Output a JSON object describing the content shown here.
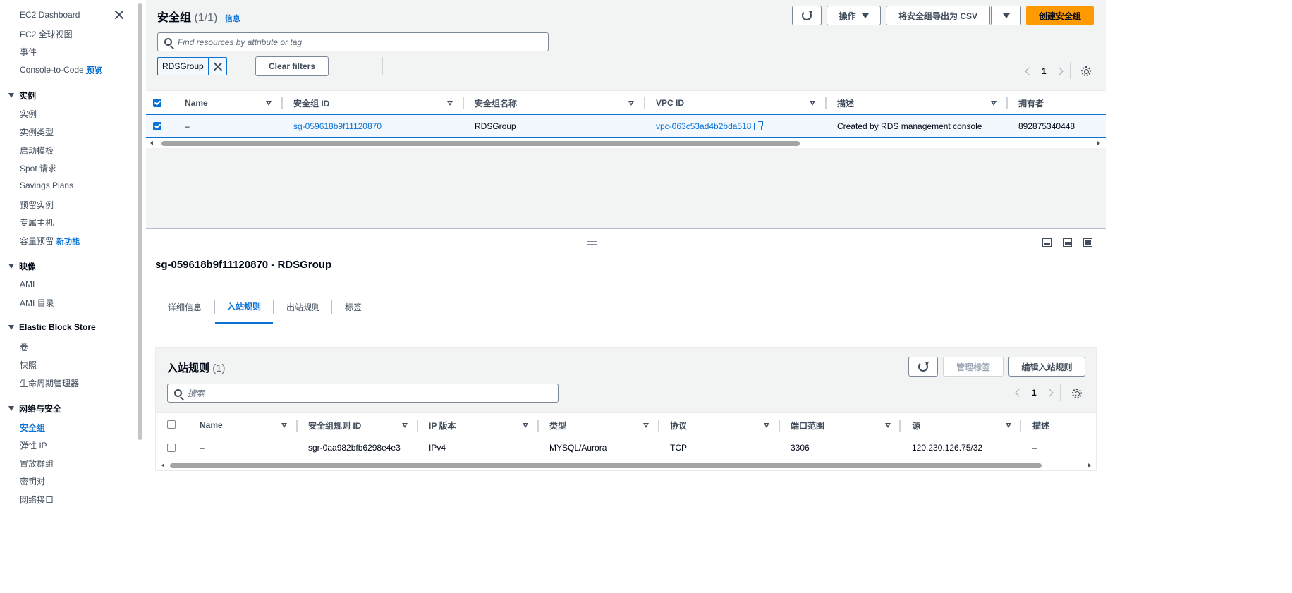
{
  "sidebar": {
    "top_items": [
      {
        "label": "EC2 Dashboard"
      },
      {
        "label": "EC2 全球视图"
      },
      {
        "label": "事件"
      },
      {
        "label": "Console-to-Code",
        "badge": "预览"
      }
    ],
    "sections": [
      {
        "title": "实例",
        "items": [
          {
            "label": "实例"
          },
          {
            "label": "实例类型"
          },
          {
            "label": "启动模板"
          },
          {
            "label": "Spot 请求"
          },
          {
            "label": "Savings Plans"
          },
          {
            "label": "预留实例"
          },
          {
            "label": "专属主机"
          },
          {
            "label": "容量预留",
            "badge": "新功能"
          }
        ]
      },
      {
        "title": "映像",
        "items": [
          {
            "label": "AMI"
          },
          {
            "label": "AMI 目录"
          }
        ]
      },
      {
        "title": "Elastic Block Store",
        "items": [
          {
            "label": "卷"
          },
          {
            "label": "快照"
          },
          {
            "label": "生命周期管理器"
          }
        ]
      },
      {
        "title": "网络与安全",
        "items": [
          {
            "label": "安全组",
            "active": true
          },
          {
            "label": "弹性 IP"
          },
          {
            "label": "置放群组"
          },
          {
            "label": "密钥对"
          },
          {
            "label": "网络接口"
          }
        ]
      }
    ]
  },
  "header": {
    "title": "安全组",
    "count": "(1/1)",
    "info": "信息",
    "actions_label": "操作",
    "export_label": "将安全组导出为 CSV",
    "create_label": "创建安全组"
  },
  "filter": {
    "placeholder": "Find resources by attribute or tag",
    "token": "RDSGroup",
    "clear_label": "Clear filters"
  },
  "pagination": {
    "page": "1"
  },
  "table": {
    "columns": [
      "Name",
      "安全组 ID",
      "安全组名称",
      "VPC ID",
      "描述",
      "拥有者"
    ],
    "rows": [
      {
        "name": "–",
        "sg_id": "sg-059618b9f11120870",
        "sg_name": "RDSGroup",
        "vpc_id": "vpc-063c53ad4b2bda518",
        "description": "Created by RDS management console",
        "owner": "892875340448",
        "selected": true
      }
    ]
  },
  "detail": {
    "title": "sg-059618b9f11120870 - RDSGroup",
    "tabs": [
      "详细信息",
      "入站规则",
      "出站规则",
      "标签"
    ],
    "active_tab": 1
  },
  "inbound": {
    "title": "入站规则",
    "count": "(1)",
    "manage_tags_label": "管理标签",
    "edit_label": "编辑入站规则",
    "search_placeholder": "搜索",
    "page": "1",
    "columns": [
      "Name",
      "安全组规则 ID",
      "IP 版本",
      "类型",
      "协议",
      "端口范围",
      "源",
      "描述"
    ],
    "rows": [
      {
        "name": "–",
        "rule_id": "sgr-0aa982bfb6298e4e3",
        "ip_version": "IPv4",
        "type": "MYSQL/Aurora",
        "protocol": "TCP",
        "port_range": "3306",
        "source": "120.230.126.75/32",
        "description": "–"
      }
    ]
  },
  "colors": {
    "accent": "#0972d3",
    "primary_button": "#ff9900",
    "panel_bg": "#f2f3f3"
  }
}
